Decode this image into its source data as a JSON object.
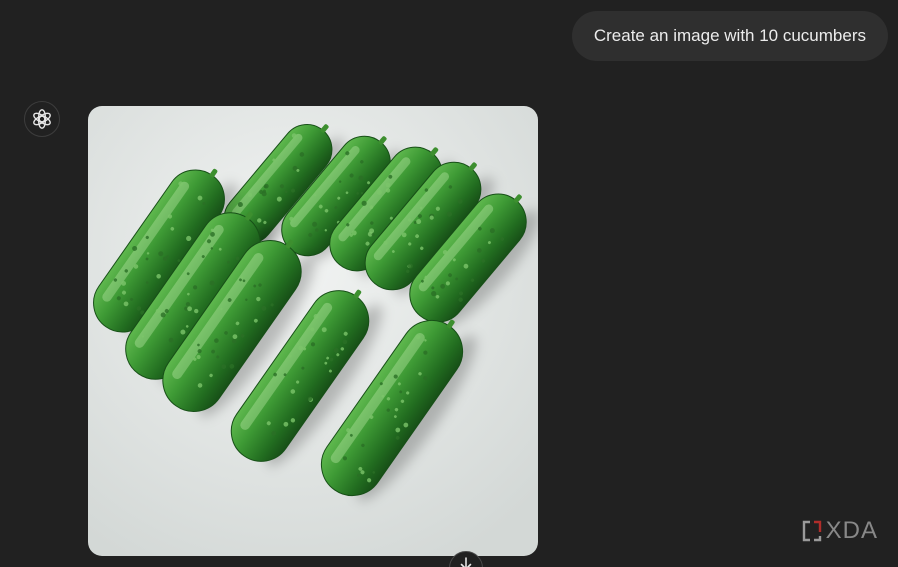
{
  "user_message": {
    "text": "Create an image with 10 cucumbers"
  },
  "assistant": {
    "avatar_icon": "openai-logo-icon",
    "image": {
      "subject": "cucumber",
      "count": 10,
      "background_color": "#e9ecea"
    }
  },
  "scroll_button": {
    "icon": "arrow-down-icon"
  },
  "watermark": {
    "text": "XDA",
    "icon": "xda-logo-icon"
  },
  "colors": {
    "background": "#212121",
    "bubble": "#2f2f2f",
    "text": "#ececec",
    "cucumber_light": "#3f9a36",
    "cucumber_dark": "#1d5a1c"
  }
}
